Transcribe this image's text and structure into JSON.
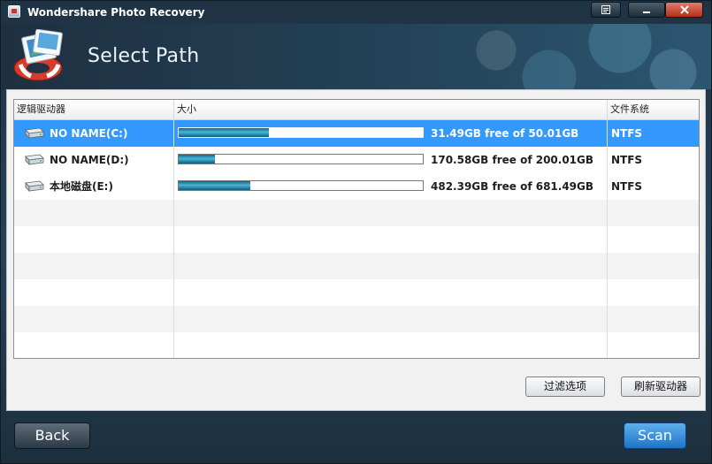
{
  "window": {
    "title": "Wondershare Photo Recovery"
  },
  "header": {
    "title": "Select Path"
  },
  "table": {
    "columns": [
      "逻辑驱动器",
      "大小",
      "文件系统"
    ],
    "rows": [
      {
        "name": "NO NAME(C:)",
        "size": "31.49GB free of 50.01GB",
        "fs": "NTFS",
        "used_fraction": 0.37
      },
      {
        "name": "NO NAME(D:)",
        "size": "170.58GB free of 200.01GB",
        "fs": "NTFS",
        "used_fraction": 0.147
      },
      {
        "name": "本地磁盘(E:)",
        "size": "482.39GB free of 681.49GB",
        "fs": "NTFS",
        "used_fraction": 0.292
      }
    ]
  },
  "buttons": {
    "filter": "过滤选项",
    "refresh": "刷新驱动器",
    "back": "Back",
    "scan": "Scan"
  },
  "icons": {
    "restore": "restore-icon",
    "minimize": "minimize-icon",
    "close": "close-icon",
    "drive": "hard-drive-icon"
  },
  "colors": {
    "selection": "#3399ff",
    "progress": "#2a8fb5",
    "scan_button": "#2a7fd4"
  }
}
